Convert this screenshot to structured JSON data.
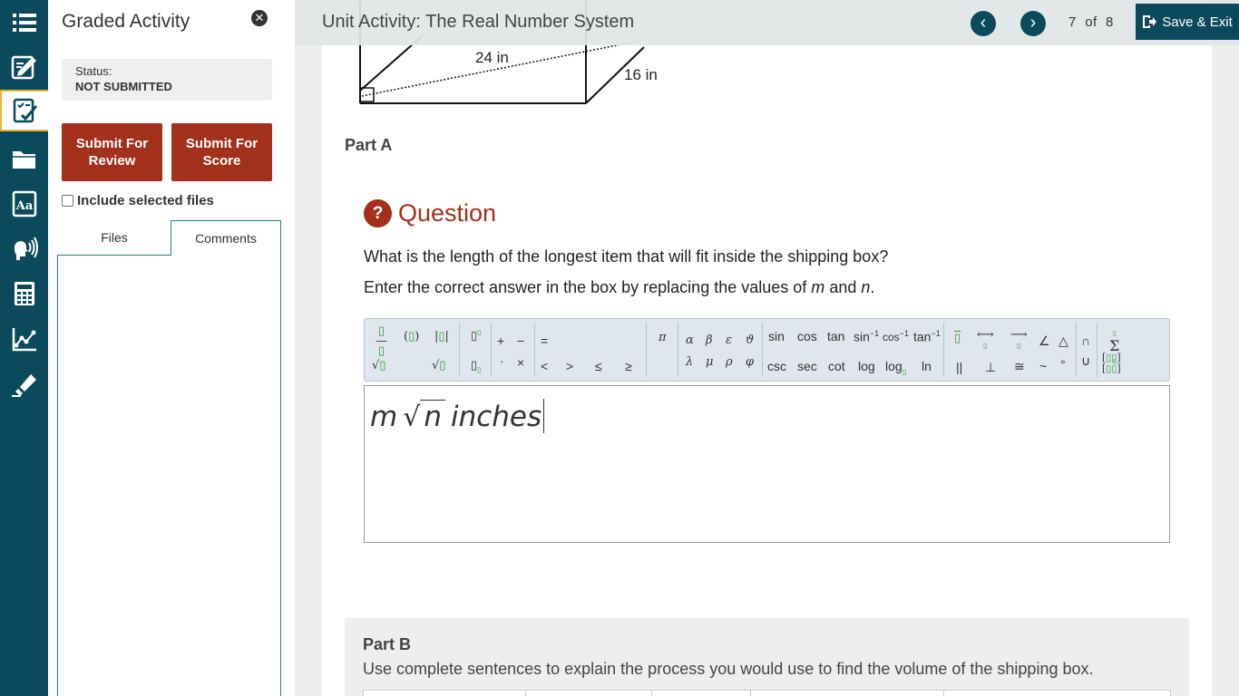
{
  "rail": {
    "items": [
      {
        "icon": "list-icon"
      },
      {
        "icon": "edit-icon"
      },
      {
        "icon": "checklist-icon"
      },
      {
        "icon": "folder-icon"
      },
      {
        "icon": "glossary-icon"
      },
      {
        "icon": "speak-icon"
      },
      {
        "icon": "calculator-icon"
      },
      {
        "icon": "graph-icon"
      },
      {
        "icon": "highlighter-icon"
      }
    ]
  },
  "panel": {
    "title": "Graded Activity",
    "status_label": "Status:",
    "status_value": "NOT SUBMITTED",
    "submit_review": "Submit For Review",
    "submit_score": "Submit For Score",
    "include_files": "Include selected files",
    "tabs": [
      "Files",
      "Comments"
    ]
  },
  "topbar": {
    "title": "Unit Activity: The Real Number System",
    "page_current": "7",
    "page_of": "of",
    "page_total": "8",
    "save_exit": "Save & Exit"
  },
  "diagram": {
    "label_diag": "24 in",
    "label_side": "16 in"
  },
  "part_a": {
    "title": "Part A",
    "question_label": "Question",
    "question_text": "What is the length of the longest item that will fit inside the shipping box?",
    "instruction_pre": "Enter the correct answer in the box by replacing the values of",
    "var_m": "m",
    "instruction_and": "and",
    "var_n": "n",
    "instruction_end": ".",
    "answer": {
      "m": "m",
      "n": "n",
      "units": "inches"
    }
  },
  "equation_toolbar": {
    "trig_top": [
      "sin",
      "cos",
      "tan"
    ],
    "trig_bottom": [
      "csc",
      "sec",
      "cot",
      "log"
    ],
    "ln": "ln",
    "greek_top": [
      "α",
      "β",
      "ε",
      "ϑ"
    ],
    "greek_bottom": [
      "λ",
      "μ",
      "ρ",
      "φ"
    ]
  },
  "part_b": {
    "title": "Part B",
    "text": "Use complete sentences to explain the process you would use to find the volume of the shipping box."
  }
}
